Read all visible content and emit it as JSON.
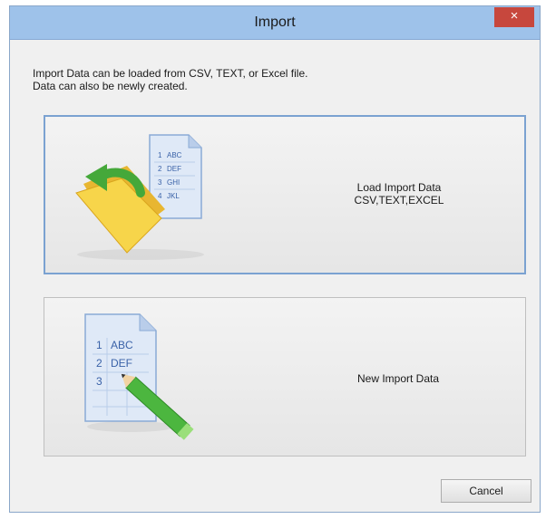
{
  "window": {
    "title": "Import",
    "close_label": "×"
  },
  "description": {
    "line1": "Import Data can be loaded from CSV, TEXT, or Excel file.",
    "line2": "Data can also be newly created."
  },
  "load_button": {
    "label_line1": "Load Import Data",
    "label_line2": "CSV,TEXT,EXCEL",
    "icon": "folder-load-icon",
    "doc_rows": [
      {
        "num": "1",
        "text": "ABC"
      },
      {
        "num": "2",
        "text": "DEF"
      },
      {
        "num": "3",
        "text": "GHI"
      },
      {
        "num": "4",
        "text": "JKL"
      }
    ]
  },
  "new_button": {
    "label": "New Import Data",
    "icon": "document-pencil-icon",
    "doc_rows": [
      {
        "num": "1",
        "text": "ABC"
      },
      {
        "num": "2",
        "text": "DEF"
      },
      {
        "num": "3",
        "text": ""
      }
    ]
  },
  "cancel_label": "Cancel",
  "colors": {
    "titlebar": "#9ec2ea",
    "close": "#c7473d",
    "selected_border": "#7ba2d1"
  }
}
